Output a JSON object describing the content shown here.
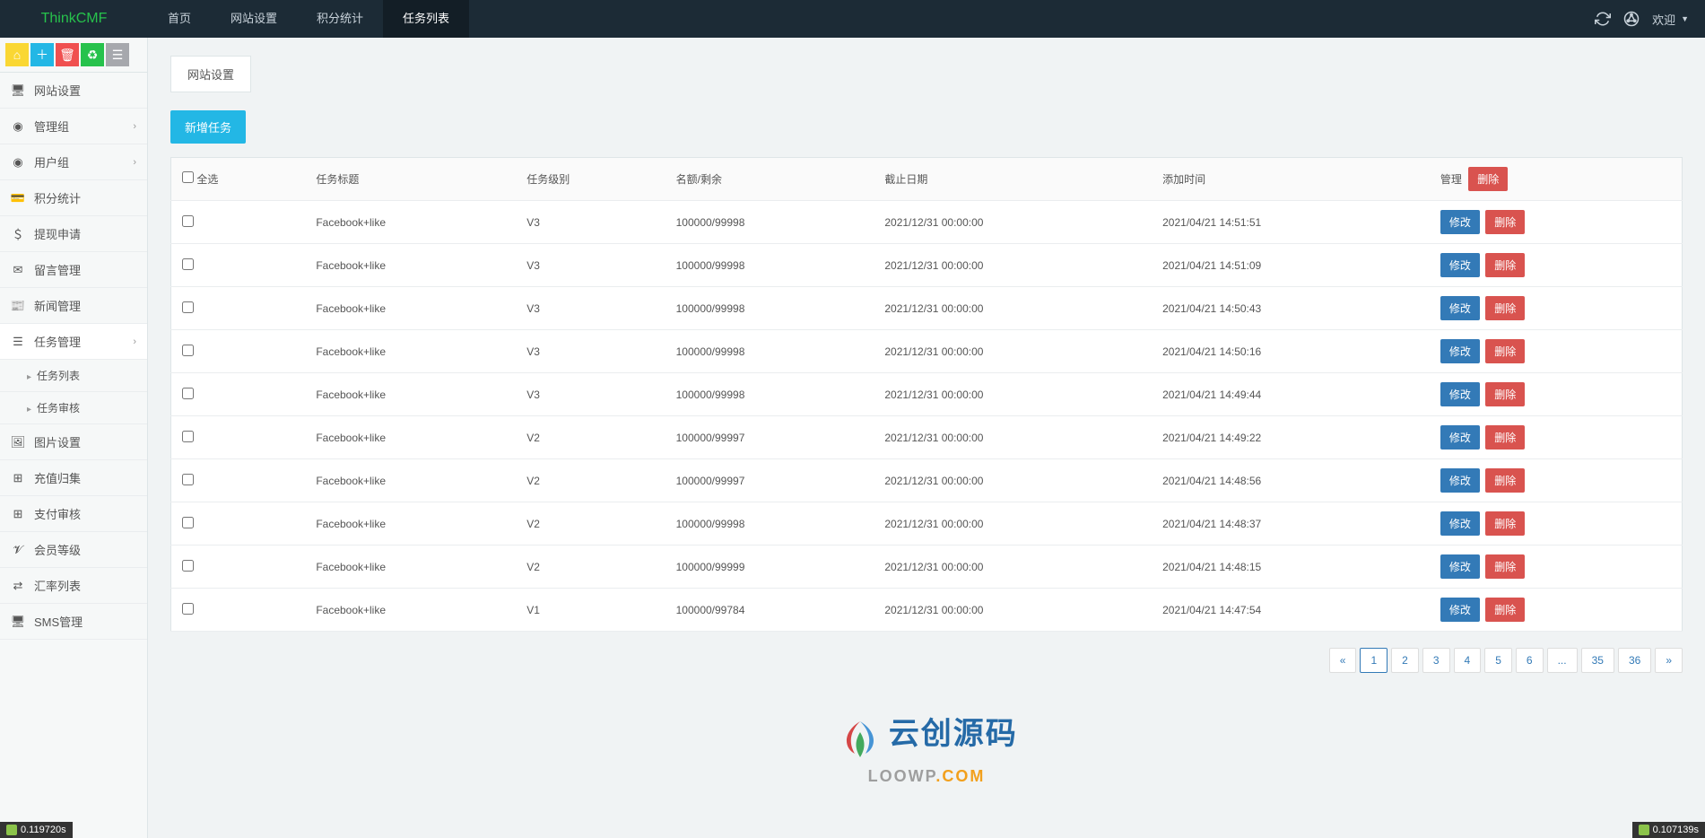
{
  "brand": "ThinkCMF",
  "topnav": {
    "home": "首页",
    "site": "网站设置",
    "points": "积分统计",
    "tasks": "任务列表"
  },
  "topright": {
    "welcome": "欢迎"
  },
  "sidebar": {
    "items": [
      {
        "label": "网站设置"
      },
      {
        "label": "管理组",
        "expandable": true
      },
      {
        "label": "用户组",
        "expandable": true
      },
      {
        "label": "积分统计"
      },
      {
        "label": "提现申请"
      },
      {
        "label": "留言管理"
      },
      {
        "label": "新闻管理"
      },
      {
        "label": "任务管理",
        "expandable": true,
        "active": true
      },
      {
        "label": "图片设置"
      },
      {
        "label": "充值归集"
      },
      {
        "label": "支付审核"
      },
      {
        "label": "会员等级"
      },
      {
        "label": "汇率列表"
      },
      {
        "label": "SMS管理"
      }
    ],
    "subitems": {
      "tasks_list": "任务列表",
      "tasks_audit": "任务审核"
    }
  },
  "main": {
    "tab_label": "网站设置",
    "add_btn": "新增任务",
    "columns": {
      "selectall": "全选",
      "title": "任务标题",
      "level": "任务级别",
      "quota": "名额/剩余",
      "deadline": "截止日期",
      "addtime": "添加时间",
      "manage": "管理",
      "del_hdr": "删除"
    },
    "row_actions": {
      "edit": "修改",
      "del": "删除"
    },
    "rows": [
      {
        "title": "Facebook+like",
        "level": "V3",
        "quota": "100000/99998",
        "deadline": "2021/12/31 00:00:00",
        "addtime": "2021/04/21 14:51:51"
      },
      {
        "title": "Facebook+like",
        "level": "V3",
        "quota": "100000/99998",
        "deadline": "2021/12/31 00:00:00",
        "addtime": "2021/04/21 14:51:09"
      },
      {
        "title": "Facebook+like",
        "level": "V3",
        "quota": "100000/99998",
        "deadline": "2021/12/31 00:00:00",
        "addtime": "2021/04/21 14:50:43"
      },
      {
        "title": "Facebook+like",
        "level": "V3",
        "quota": "100000/99998",
        "deadline": "2021/12/31 00:00:00",
        "addtime": "2021/04/21 14:50:16"
      },
      {
        "title": "Facebook+like",
        "level": "V3",
        "quota": "100000/99998",
        "deadline": "2021/12/31 00:00:00",
        "addtime": "2021/04/21 14:49:44"
      },
      {
        "title": "Facebook+like",
        "level": "V2",
        "quota": "100000/99997",
        "deadline": "2021/12/31 00:00:00",
        "addtime": "2021/04/21 14:49:22"
      },
      {
        "title": "Facebook+like",
        "level": "V2",
        "quota": "100000/99997",
        "deadline": "2021/12/31 00:00:00",
        "addtime": "2021/04/21 14:48:56"
      },
      {
        "title": "Facebook+like",
        "level": "V2",
        "quota": "100000/99998",
        "deadline": "2021/12/31 00:00:00",
        "addtime": "2021/04/21 14:48:37"
      },
      {
        "title": "Facebook+like",
        "level": "V2",
        "quota": "100000/99999",
        "deadline": "2021/12/31 00:00:00",
        "addtime": "2021/04/21 14:48:15"
      },
      {
        "title": "Facebook+like",
        "level": "V1",
        "quota": "100000/99784",
        "deadline": "2021/12/31 00:00:00",
        "addtime": "2021/04/21 14:47:54"
      }
    ],
    "pagination": [
      "«",
      "1",
      "2",
      "3",
      "4",
      "5",
      "6",
      "...",
      "35",
      "36",
      "»"
    ]
  },
  "watermark": {
    "cn": "云创源码",
    "en1": "LOOWP",
    "en2": ".COM"
  },
  "perf": {
    "left": "0.119720s",
    "right": "0.107139s"
  }
}
